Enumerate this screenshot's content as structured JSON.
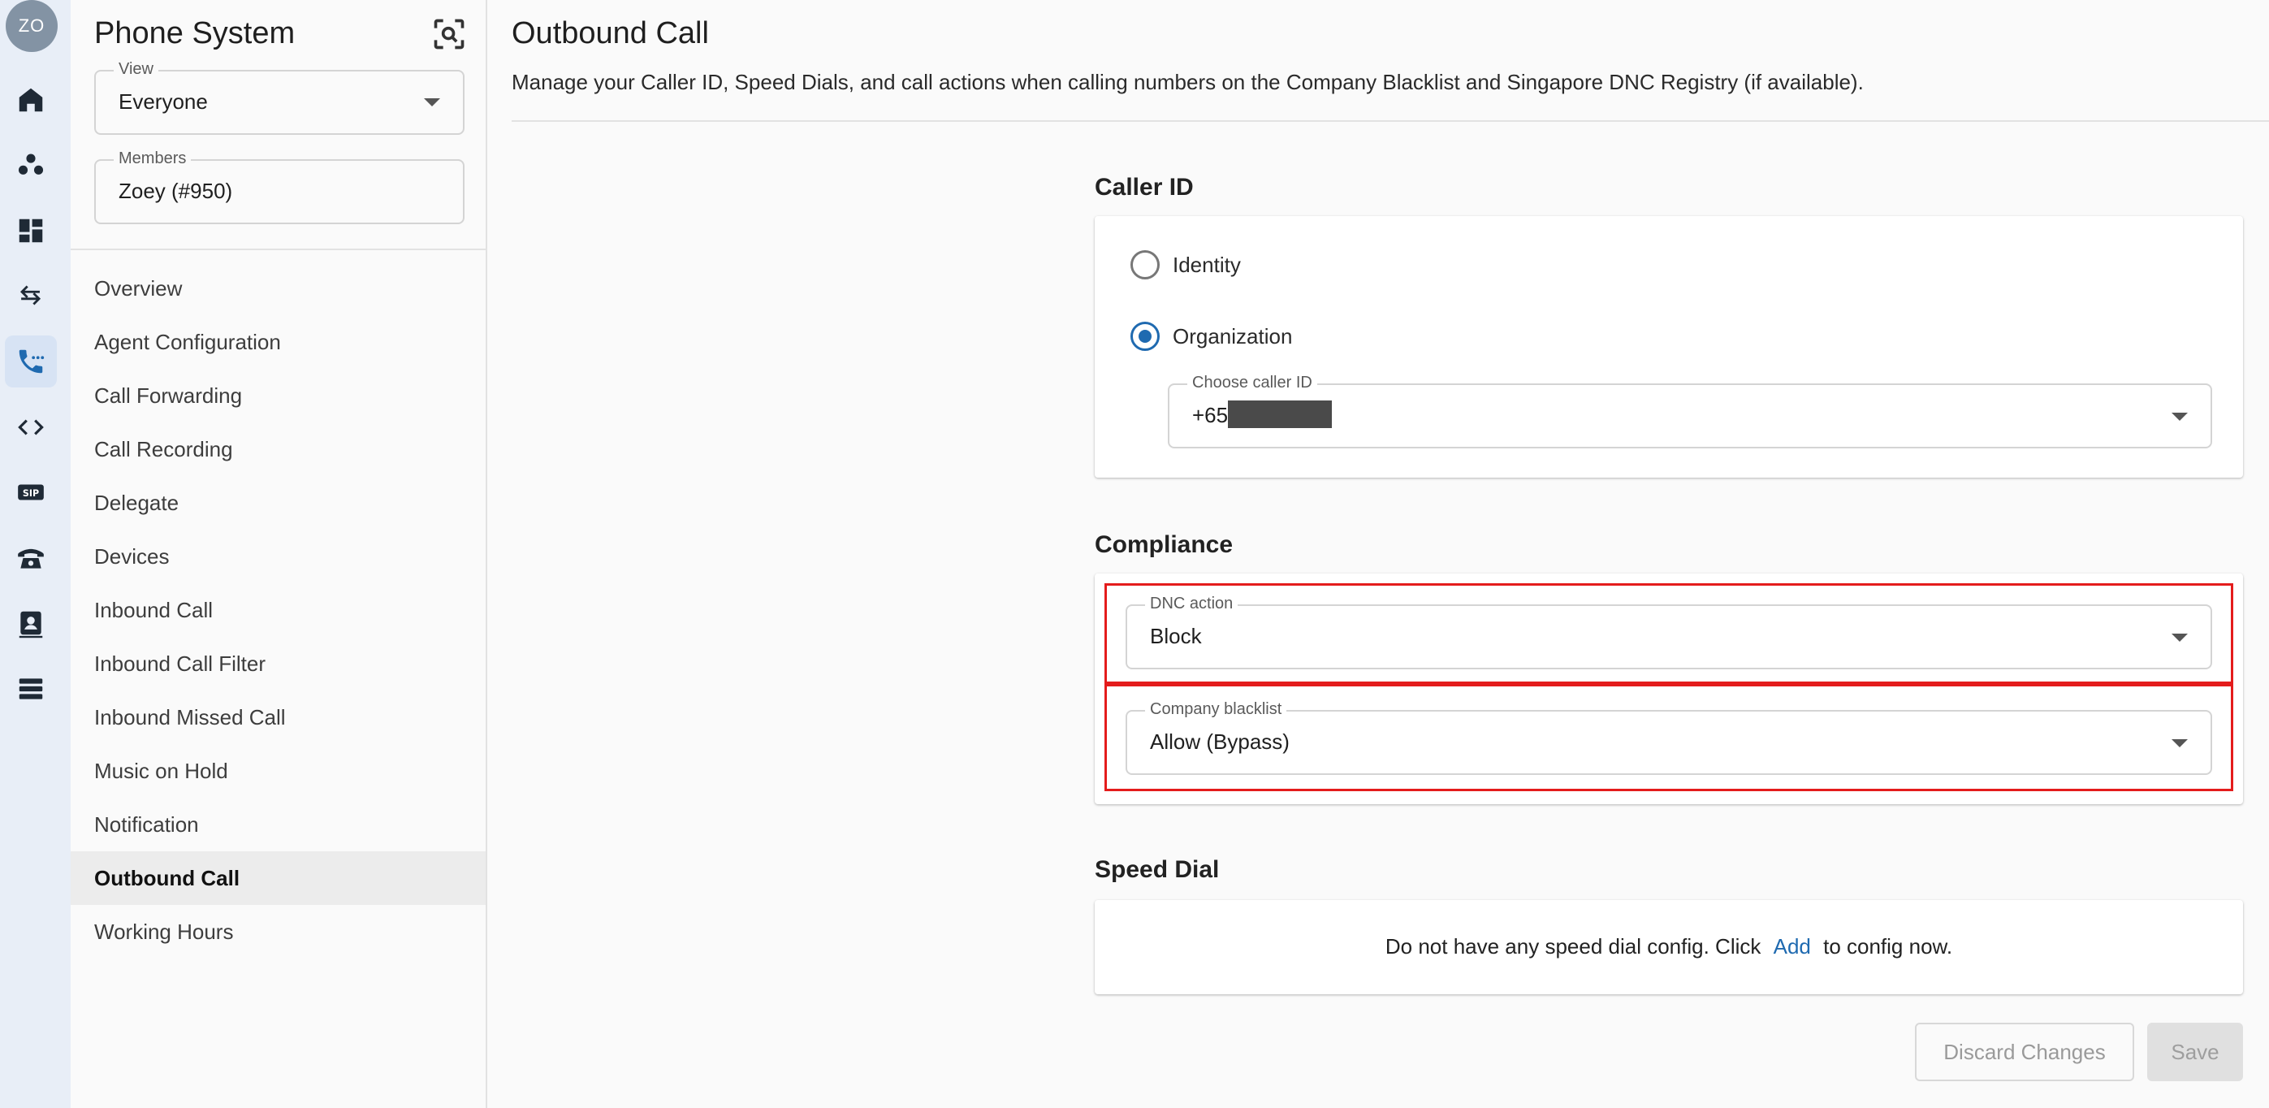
{
  "rail": {
    "avatar_initials": "ZO",
    "items": [
      {
        "icon": "home-icon"
      },
      {
        "icon": "group-icon"
      },
      {
        "icon": "dashboard-icon"
      },
      {
        "icon": "transfer-arrows-icon"
      },
      {
        "icon": "phone-dots-icon",
        "active": true
      },
      {
        "icon": "code-icon"
      },
      {
        "icon": "sip-icon",
        "text": "SIP"
      },
      {
        "icon": "desk-phone-icon"
      },
      {
        "icon": "contact-card-icon"
      },
      {
        "icon": "storage-list-icon"
      }
    ]
  },
  "sidebar": {
    "title": "Phone System",
    "view": {
      "label": "View",
      "value": "Everyone"
    },
    "members": {
      "label": "Members",
      "value": "Zoey (#950)"
    },
    "items": [
      {
        "label": "Overview"
      },
      {
        "label": "Agent Configuration"
      },
      {
        "label": "Call Forwarding"
      },
      {
        "label": "Call Recording"
      },
      {
        "label": "Delegate"
      },
      {
        "label": "Devices"
      },
      {
        "label": "Inbound Call"
      },
      {
        "label": "Inbound Call Filter"
      },
      {
        "label": "Inbound Missed Call"
      },
      {
        "label": "Music on Hold"
      },
      {
        "label": "Notification"
      },
      {
        "label": "Outbound Call",
        "active": true
      },
      {
        "label": "Working Hours"
      }
    ]
  },
  "main": {
    "title": "Outbound Call",
    "description": "Manage your Caller ID, Speed Dials, and call actions when calling numbers on the Company Blacklist and Singapore DNC Registry (if available).",
    "caller_id": {
      "title": "Caller ID",
      "options": [
        {
          "label": "Identity",
          "selected": false
        },
        {
          "label": "Organization",
          "selected": true
        }
      ],
      "choose_label": "Choose caller ID",
      "choose_value": "+65"
    },
    "compliance": {
      "title": "Compliance",
      "dnc_label": "DNC action",
      "dnc_value": "Block",
      "blacklist_label": "Company blacklist",
      "blacklist_value": "Allow (Bypass)"
    },
    "speed_dial": {
      "title": "Speed Dial",
      "message_before": "Do not have any speed dial config. Click",
      "link": "Add",
      "message_after": "to config now."
    },
    "buttons": {
      "discard": "Discard Changes",
      "save": "Save"
    }
  },
  "colors": {
    "accent": "#1f6ab0",
    "highlight": "#e41c1c",
    "rail_bg": "#e8eef7"
  }
}
